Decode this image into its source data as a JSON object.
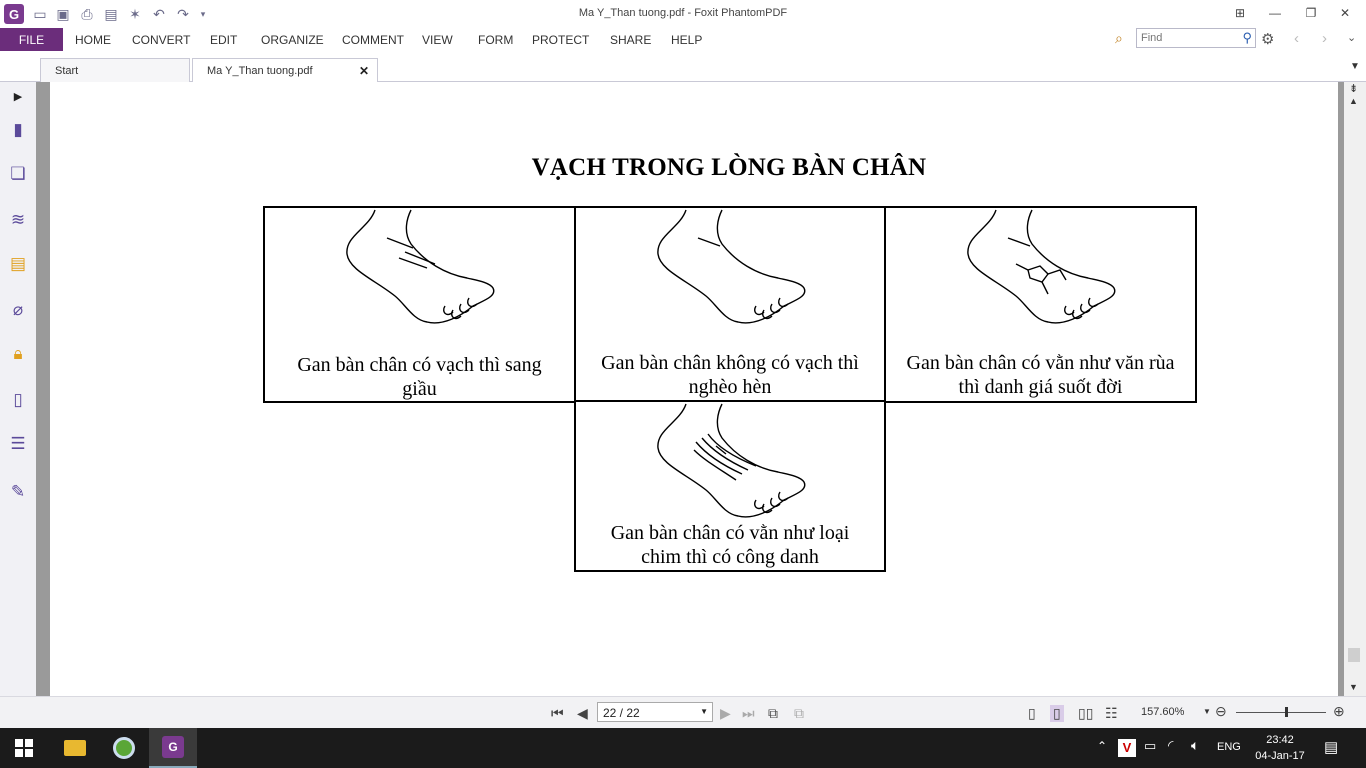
{
  "window": {
    "title": "Ma Y_Than tuong.pdf - Foxit PhantomPDF"
  },
  "quick_access": [
    "open-icon",
    "save-icon",
    "print-icon",
    "scan-icon",
    "new-icon",
    "undo-icon",
    "redo-icon",
    "customize-icon"
  ],
  "menu": {
    "file_label": "FILE",
    "items": [
      "HOME",
      "CONVERT",
      "EDIT",
      "ORGANIZE",
      "COMMENT",
      "VIEW",
      "FORM",
      "PROTECT",
      "SHARE",
      "HELP"
    ]
  },
  "search": {
    "placeholder": "Find"
  },
  "tabs": [
    {
      "label": "Start"
    },
    {
      "label": "Ma Y_Than tuong.pdf"
    }
  ],
  "sidebar": [
    "bookmarks-icon",
    "pages-icon",
    "layers-icon",
    "comments-icon",
    "attachments-icon",
    "security-icon",
    "content-icon",
    "fields-icon",
    "signature-icon"
  ],
  "document": {
    "title": "VẠCH TRONG LÒNG BÀN CHÂN",
    "cells": [
      {
        "caption_1": "Gan bàn chân có vạch thì sang",
        "caption_2": "giầu"
      },
      {
        "caption_1": "Gan bàn chân không có vạch thì",
        "caption_2": "nghèo hèn"
      },
      {
        "caption_1": "Gan bàn chân có vằn như văn rùa",
        "caption_2": "thì danh giá suốt đời"
      },
      {
        "caption_1": "Gan bàn chân có vằn như loại",
        "caption_2": "chim thì có công danh"
      }
    ]
  },
  "status": {
    "page": "22 / 22",
    "zoom": "157.60%"
  },
  "taskbar": {
    "language": "ENG",
    "time": "23:42",
    "date": "04-Jan-17"
  },
  "colors": {
    "accent": "#6b2d7b",
    "file_button": "#6b2d7b",
    "icon_purple": "#5b4a9a"
  }
}
